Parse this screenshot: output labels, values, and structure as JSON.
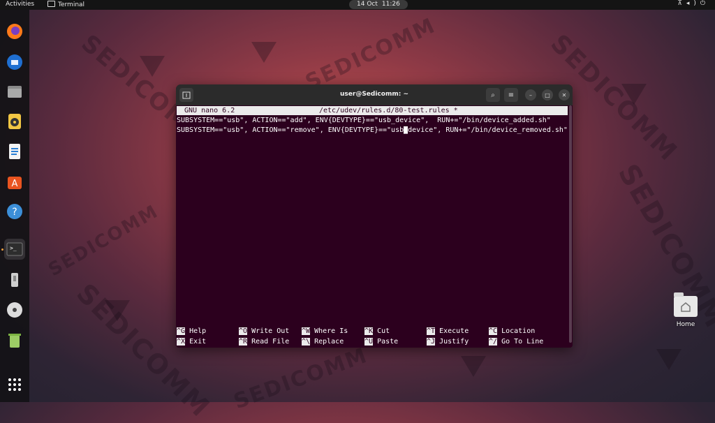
{
  "topbar": {
    "activities": "Activities",
    "app_name": "Terminal",
    "date": "14 Oct",
    "time": "11:26"
  },
  "dock": {
    "items": [
      {
        "name": "firefox",
        "color": "#e66000"
      },
      {
        "name": "thunderbird",
        "color": "#1f6fd1"
      },
      {
        "name": "files",
        "color": "#9a9a9a"
      },
      {
        "name": "rhythmbox",
        "color": "#f2c744"
      },
      {
        "name": "libreoffice-writer",
        "color": "#2a7fd4"
      },
      {
        "name": "software",
        "color": "#e95420"
      },
      {
        "name": "help",
        "color": "#3c8fd8"
      },
      {
        "name": "terminal",
        "color": "#333333"
      },
      {
        "name": "usb-drive",
        "color": "#bbbbbb"
      },
      {
        "name": "dvd",
        "color": "#cccccc"
      },
      {
        "name": "trash",
        "color": "#8bc34a"
      }
    ]
  },
  "desktop": {
    "home_label": "Home"
  },
  "window": {
    "title": "user@Sedicomm: ~"
  },
  "nano": {
    "version": "GNU nano 6.2",
    "file": "/etc/udev/rules.d/80-test.rules *",
    "line1": "SUBSYSTEM==\"usb\", ACTION==\"add\", ENV{DEVTYPE}==\"usb_device\",  RUN+=\"/bin/device_added.sh\"",
    "line2_before_cursor": "SUBSYSTEM==\"usb\", ACTION==\"remove\", ENV{DEVTYPE}==\"usb",
    "line2_cursor": "_",
    "line2_after_cursor": "device\", RUN+=\"/bin/device_removed.sh\"",
    "shortcuts": [
      {
        "key": "^G",
        "label": "Help"
      },
      {
        "key": "^O",
        "label": "Write Out"
      },
      {
        "key": "^W",
        "label": "Where Is"
      },
      {
        "key": "^K",
        "label": "Cut"
      },
      {
        "key": "^T",
        "label": "Execute"
      },
      {
        "key": "^C",
        "label": "Location"
      },
      {
        "key": "^X",
        "label": "Exit"
      },
      {
        "key": "^R",
        "label": "Read File"
      },
      {
        "key": "^\\",
        "label": "Replace"
      },
      {
        "key": "^U",
        "label": "Paste"
      },
      {
        "key": "^J",
        "label": "Justify"
      },
      {
        "key": "^/",
        "label": "Go To Line"
      }
    ]
  },
  "watermark": "SEDICOMM"
}
